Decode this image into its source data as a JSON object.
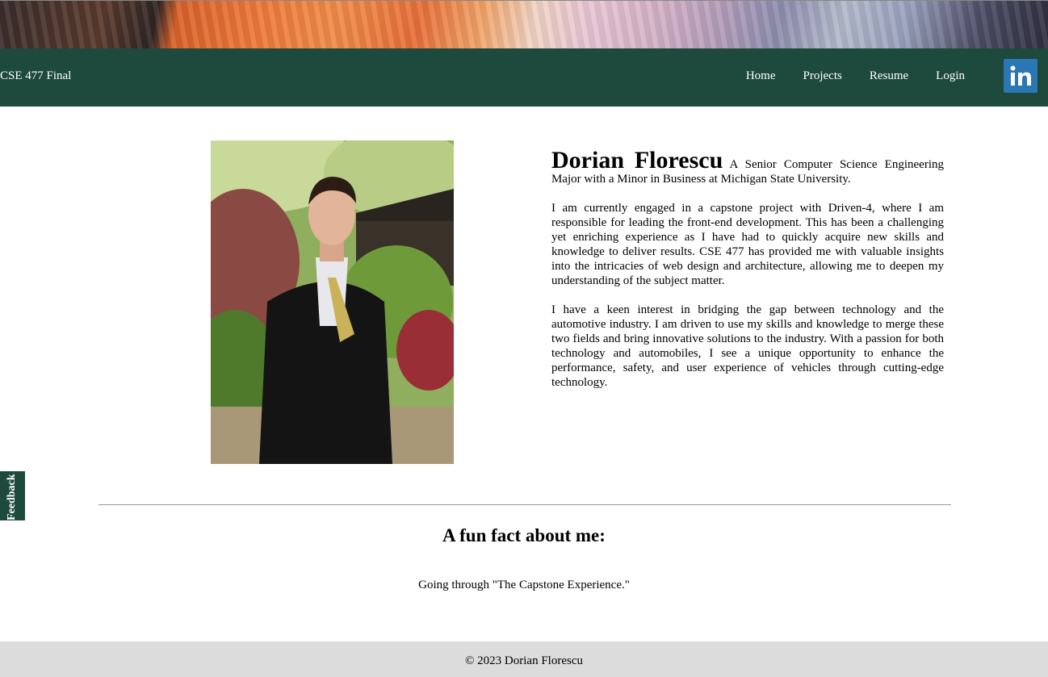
{
  "header": {
    "brand": "CSE 477 Final",
    "nav": [
      {
        "label": "Home"
      },
      {
        "label": "Projects"
      },
      {
        "label": "Resume"
      },
      {
        "label": "Login"
      }
    ],
    "linkedin_icon": "linkedin-icon",
    "colors": {
      "navbar": "#1d4a3d",
      "linkedin": "#2a77b4"
    }
  },
  "about": {
    "photo_icon": "profile-photo",
    "name": "Dorian Florescu",
    "tagline": "A Senior Computer Science Engineering Major with a Minor in Business at Michigan State University.",
    "paragraphs": [
      "I am currently engaged in a capstone project with Driven-4, where I am responsible for leading the front-end development. This has been a challenging yet enriching experience as I have had to quickly acquire new skills and knowledge to deliver results. CSE 477 has provided me with valuable insights into the intricacies of web design and architecture, allowing me to deepen my understanding of the subject matter.",
      "I have a keen interest in bridging the gap between technology and the automotive industry. I am driven to use my skills and knowledge to merge these two fields and bring innovative solutions to the industry. With a passion for both technology and automobiles, I see a unique opportunity to enhance the performance, safety, and user experience of vehicles through cutting-edge technology."
    ]
  },
  "fun_fact": {
    "title": "A fun fact about me:",
    "text": "Going through \"The Capstone Experience.\""
  },
  "feedback": {
    "label": "Feedback"
  },
  "footer": {
    "copyright": "© 2023 Dorian Florescu"
  }
}
